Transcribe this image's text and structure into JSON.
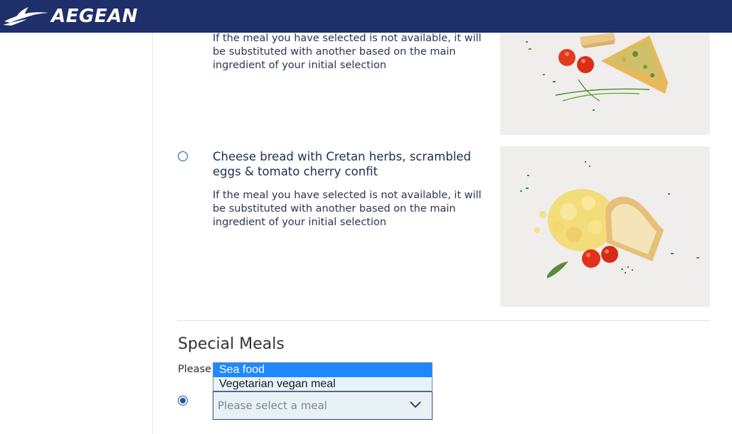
{
  "header": {
    "logo_text": "AEGEAN",
    "brand_color": "#1e2f6a"
  },
  "meals": [
    {
      "title": "",
      "note": "If the meal you have selected is not available, it will be substituted with another based on the main ingredient of your initial selection",
      "selected": false,
      "photo": "quiche-with-cherry-tomatoes-photo"
    },
    {
      "title": "Cheese bread with Cretan herbs, scrambled eggs & tomato cherry confit",
      "note": "If the meal you have selected is not available, it will be substituted with another based on the main ingredient of your initial selection",
      "selected": false,
      "photo": "scrambled-eggs-cheese-bread-photo"
    }
  ],
  "special_meals": {
    "title": "Special Meals",
    "instruction": "Please",
    "options": [
      "Sea food",
      "Vegetarian vegan meal"
    ],
    "highlighted_option": "Sea food",
    "select_placeholder": "Please select a meal",
    "radio_selected": true
  },
  "icons": {
    "dropdown": "chevron-down-icon",
    "logo": "aegean-bird-logo-icon"
  }
}
